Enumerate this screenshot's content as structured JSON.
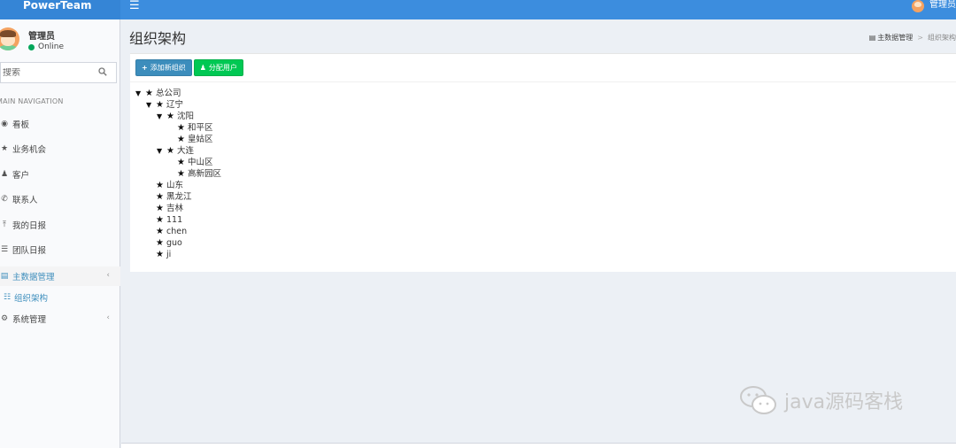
{
  "header": {
    "logo": "PowerTeam",
    "hamburger_icon": "hamburger-icon",
    "user_label": "管理员"
  },
  "sidebar": {
    "user": {
      "name": "管理员",
      "status": "Online",
      "status_color": "#00a65a"
    },
    "search": {
      "placeholder": "搜索"
    },
    "nav_header": "MAIN NAVIGATION",
    "items": [
      {
        "label": "看板",
        "icon": "dashboard-icon"
      },
      {
        "label": "业务机会",
        "icon": "star-icon"
      },
      {
        "label": "客户",
        "icon": "user-icon"
      },
      {
        "label": "联系人",
        "icon": "phone-icon"
      },
      {
        "label": "我的日报",
        "icon": "pin-icon"
      },
      {
        "label": "团队日报",
        "icon": "list-icon"
      },
      {
        "label": "主数据管理",
        "icon": "database-icon",
        "active": true
      },
      {
        "label": "组织架构",
        "icon": "sitemap-icon",
        "sub": true
      },
      {
        "label": "系统管理",
        "icon": "gears-icon"
      }
    ]
  },
  "content": {
    "title": "组织架构",
    "breadcrumb": [
      "主数据管理",
      "组织架构"
    ],
    "buttons": {
      "add": "添加新组织",
      "assign": "分配用户"
    }
  },
  "tree": [
    {
      "label": "总公司",
      "level": 0,
      "expanded": true
    },
    {
      "label": "辽宁",
      "level": 1,
      "expanded": true
    },
    {
      "label": "沈阳",
      "level": 2,
      "expanded": true
    },
    {
      "label": "和平区",
      "level": 3
    },
    {
      "label": "皇姑区",
      "level": 3
    },
    {
      "label": "大连",
      "level": 2,
      "expanded": true
    },
    {
      "label": "中山区",
      "level": 3
    },
    {
      "label": "高新园区",
      "level": 3
    },
    {
      "label": "山东",
      "level": 1
    },
    {
      "label": "黑龙江",
      "level": 1
    },
    {
      "label": "吉林",
      "level": 1
    },
    {
      "label": "111",
      "level": 1
    },
    {
      "label": "chen",
      "level": 1
    },
    {
      "label": "guo",
      "level": 1
    },
    {
      "label": "ji",
      "level": 1
    }
  ],
  "watermark": "java源码客栈",
  "colors": {
    "header": "#3c8dde",
    "primary": "#3c8dbc",
    "success": "#00c853",
    "sidebar_bg": "#f9fafc"
  }
}
